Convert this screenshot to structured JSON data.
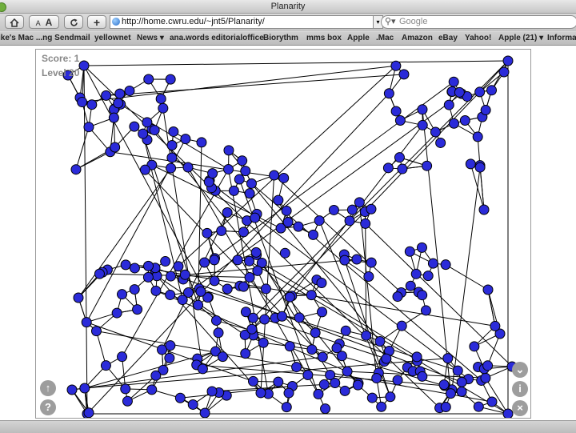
{
  "window": {
    "title": "Planarity"
  },
  "toolbar": {
    "home_icon": "home-icon",
    "text_smaller": "A",
    "text_larger": "A",
    "reload_icon": "reload-icon",
    "add_icon": "plus-icon",
    "url": "http://home.cwru.edu/~jnt5/Planarity/",
    "search_placeholder": "Google"
  },
  "bookmarks": [
    "ike's Mac ...ng Sendmail",
    "yellownet",
    "News ▾",
    "ana.words editorialoffice",
    "Biorythm",
    "mms box",
    "Apple",
    ".Mac",
    "Amazon",
    "eBay",
    "Yahoo!",
    "Apple (21) ▾",
    "Informa"
  ],
  "game": {
    "score_text": "Score: 1",
    "level_text": "Level 20",
    "node_color": "#2b2bd9",
    "controls": [
      "up-arrow-icon",
      "help-icon",
      "chevron-down-icon",
      "info-icon",
      "close-icon"
    ]
  }
}
